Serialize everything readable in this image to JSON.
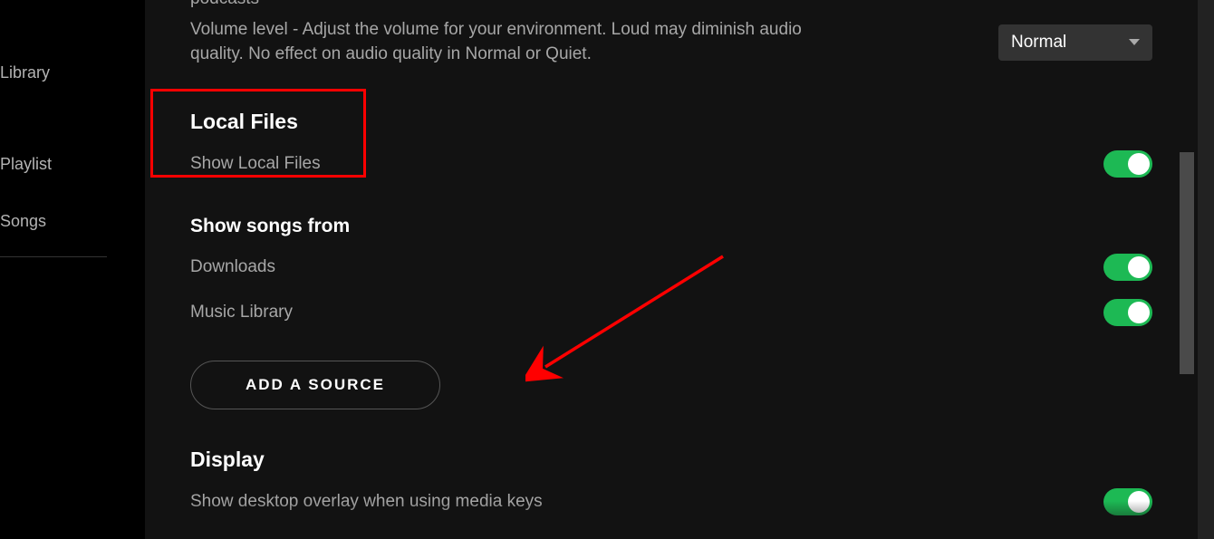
{
  "sidebar": {
    "items": [
      {
        "label": "Library"
      },
      {
        "label": "Playlist"
      },
      {
        "label": "Songs"
      }
    ]
  },
  "settings": {
    "podcasts_partial": "podcasts",
    "volume": {
      "description": "Volume level - Adjust the volume for your environment. Loud may diminish audio quality. No effect on audio quality in Normal or Quiet.",
      "selected": "Normal"
    },
    "local_files": {
      "title": "Local Files",
      "show_label": "Show Local Files",
      "show_enabled": true
    },
    "show_songs_from": {
      "title": "Show songs from",
      "sources": [
        {
          "label": "Downloads",
          "enabled": true
        },
        {
          "label": "Music Library",
          "enabled": true
        }
      ],
      "add_source_label": "ADD A SOURCE"
    },
    "display": {
      "title": "Display",
      "overlay_label": "Show desktop overlay when using media keys",
      "overlay_enabled": true
    }
  },
  "annotations": {
    "highlight": "local-files-section",
    "arrow_target": "add-source-button"
  },
  "colors": {
    "accent": "#1db954",
    "annotation": "#ff0000"
  }
}
